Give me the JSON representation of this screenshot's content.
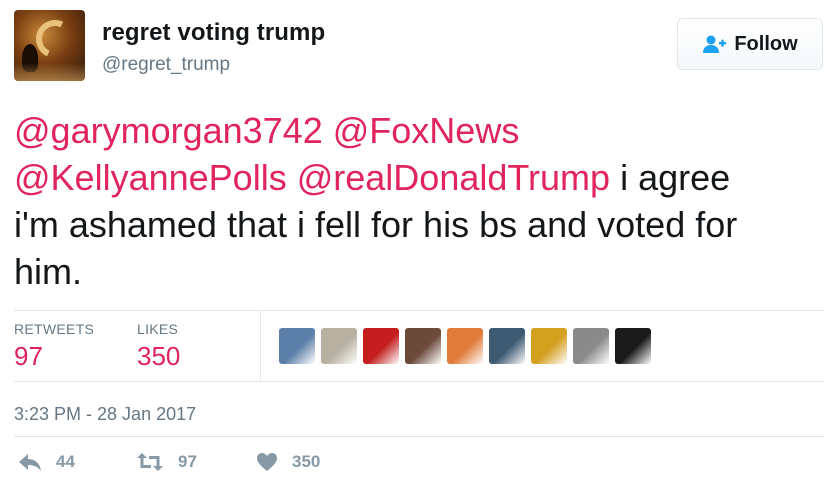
{
  "user": {
    "display_name": "regret voting trump",
    "handle": "@regret_trump",
    "avatar_icon": "profile-avatar"
  },
  "follow_button": {
    "label": "Follow",
    "icon": "add-user-icon"
  },
  "tweet": {
    "mentions": [
      "@garymorgan3742",
      "@FoxNews",
      "@KellyannePolls",
      "@realDonaldTrump"
    ],
    "text_part_1": "i agree",
    "text_part_2": "i'm ashamed that i fell for his bs and voted for",
    "text_part_3": "him."
  },
  "stats": {
    "retweets_label": "RETWEETS",
    "retweets_count": "97",
    "likes_label": "LIKES",
    "likes_count": "350"
  },
  "likers": [
    {
      "name": "liker-avatar-1",
      "color": "#5b7fa8"
    },
    {
      "name": "liker-avatar-2",
      "color": "#b8b0a0"
    },
    {
      "name": "liker-avatar-3",
      "color": "#c41e1e"
    },
    {
      "name": "liker-avatar-4",
      "color": "#6b4a3a"
    },
    {
      "name": "liker-avatar-5",
      "color": "#e07b39"
    },
    {
      "name": "liker-avatar-6",
      "color": "#3d5a73"
    },
    {
      "name": "liker-avatar-7",
      "color": "#d4a020"
    },
    {
      "name": "liker-avatar-8",
      "color": "#8a8a8a"
    },
    {
      "name": "liker-avatar-9",
      "color": "#1a1a1a"
    }
  ],
  "timestamp": "3:23 PM - 28 Jan 2017",
  "actions": {
    "reply_count": "44",
    "retweet_count": "97",
    "like_count": "350"
  },
  "colors": {
    "mention": "#e0245e",
    "secondary_text": "#657786",
    "action_icon": "#8899a6",
    "follow_icon": "#1da1f2"
  }
}
